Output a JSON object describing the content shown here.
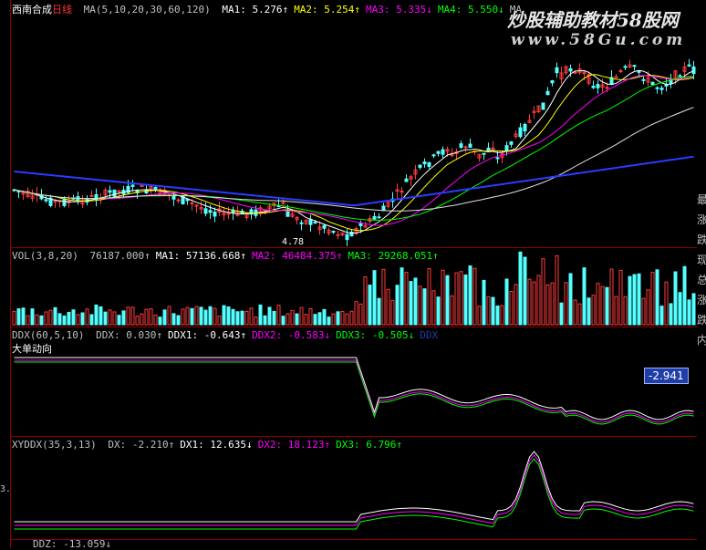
{
  "main": {
    "stock_name": "西南合成",
    "period": "日线",
    "ma_label": "MA(5,10,20,30,60,120)",
    "values": [
      {
        "label": "MA1: 5.276↑",
        "color": "#ffffff"
      },
      {
        "label": "MA2: 5.254↑",
        "color": "#ffff00"
      },
      {
        "label": "MA3: 5.335↓",
        "color": "#ff00ff"
      },
      {
        "label": "MA4: 5.550↓",
        "color": "#00ff00"
      },
      {
        "label": "MA",
        "color": "#c0c0c0"
      }
    ],
    "low_marker": "4.78",
    "watermark_title": "炒股辅助教材58股网",
    "watermark_url": "www.58Gu.com"
  },
  "vol": {
    "label": "VOL(3,8,20)",
    "values": [
      {
        "label": "76187.000↑",
        "color": "#c0c0c0"
      },
      {
        "label": "MA1: 57136.668↑",
        "color": "#ffffff"
      },
      {
        "label": "MA2: 46484.375↑",
        "color": "#ff00ff"
      },
      {
        "label": "MA3: 29268.051↑",
        "color": "#00ff00"
      }
    ]
  },
  "ddx": {
    "label": "DDX(60,5,10)",
    "values": [
      {
        "label": "DDX: 0.030↑",
        "color": "#c0c0c0"
      },
      {
        "label": "DDX1: -0.643↑",
        "color": "#ffffff"
      },
      {
        "label": "DDX2: -0.583↓",
        "color": "#ff00ff"
      },
      {
        "label": "DDX3: -0.505↓",
        "color": "#00ff00"
      },
      {
        "label": "DDX",
        "color": "#1f3ea8"
      }
    ],
    "caption": "大单动向",
    "current_value": "-2.941"
  },
  "xyddx": {
    "label": "XYDDX(35,3,13)",
    "values": [
      {
        "label": "DX: -2.210↑",
        "color": "#c0c0c0"
      },
      {
        "label": "DX1: 12.635↓",
        "color": "#ffffff"
      },
      {
        "label": "DX2: 18.123↑",
        "color": "#ff00ff"
      },
      {
        "label": "DX3: 6.796↑",
        "color": "#00ff00"
      }
    ],
    "left_tick": "3.",
    "bottom_label": "DDZ: -13.059↓"
  },
  "right_edge_chars": [
    "最",
    "涨",
    "跌",
    "现",
    "总",
    "涨",
    "跌",
    "内"
  ]
}
